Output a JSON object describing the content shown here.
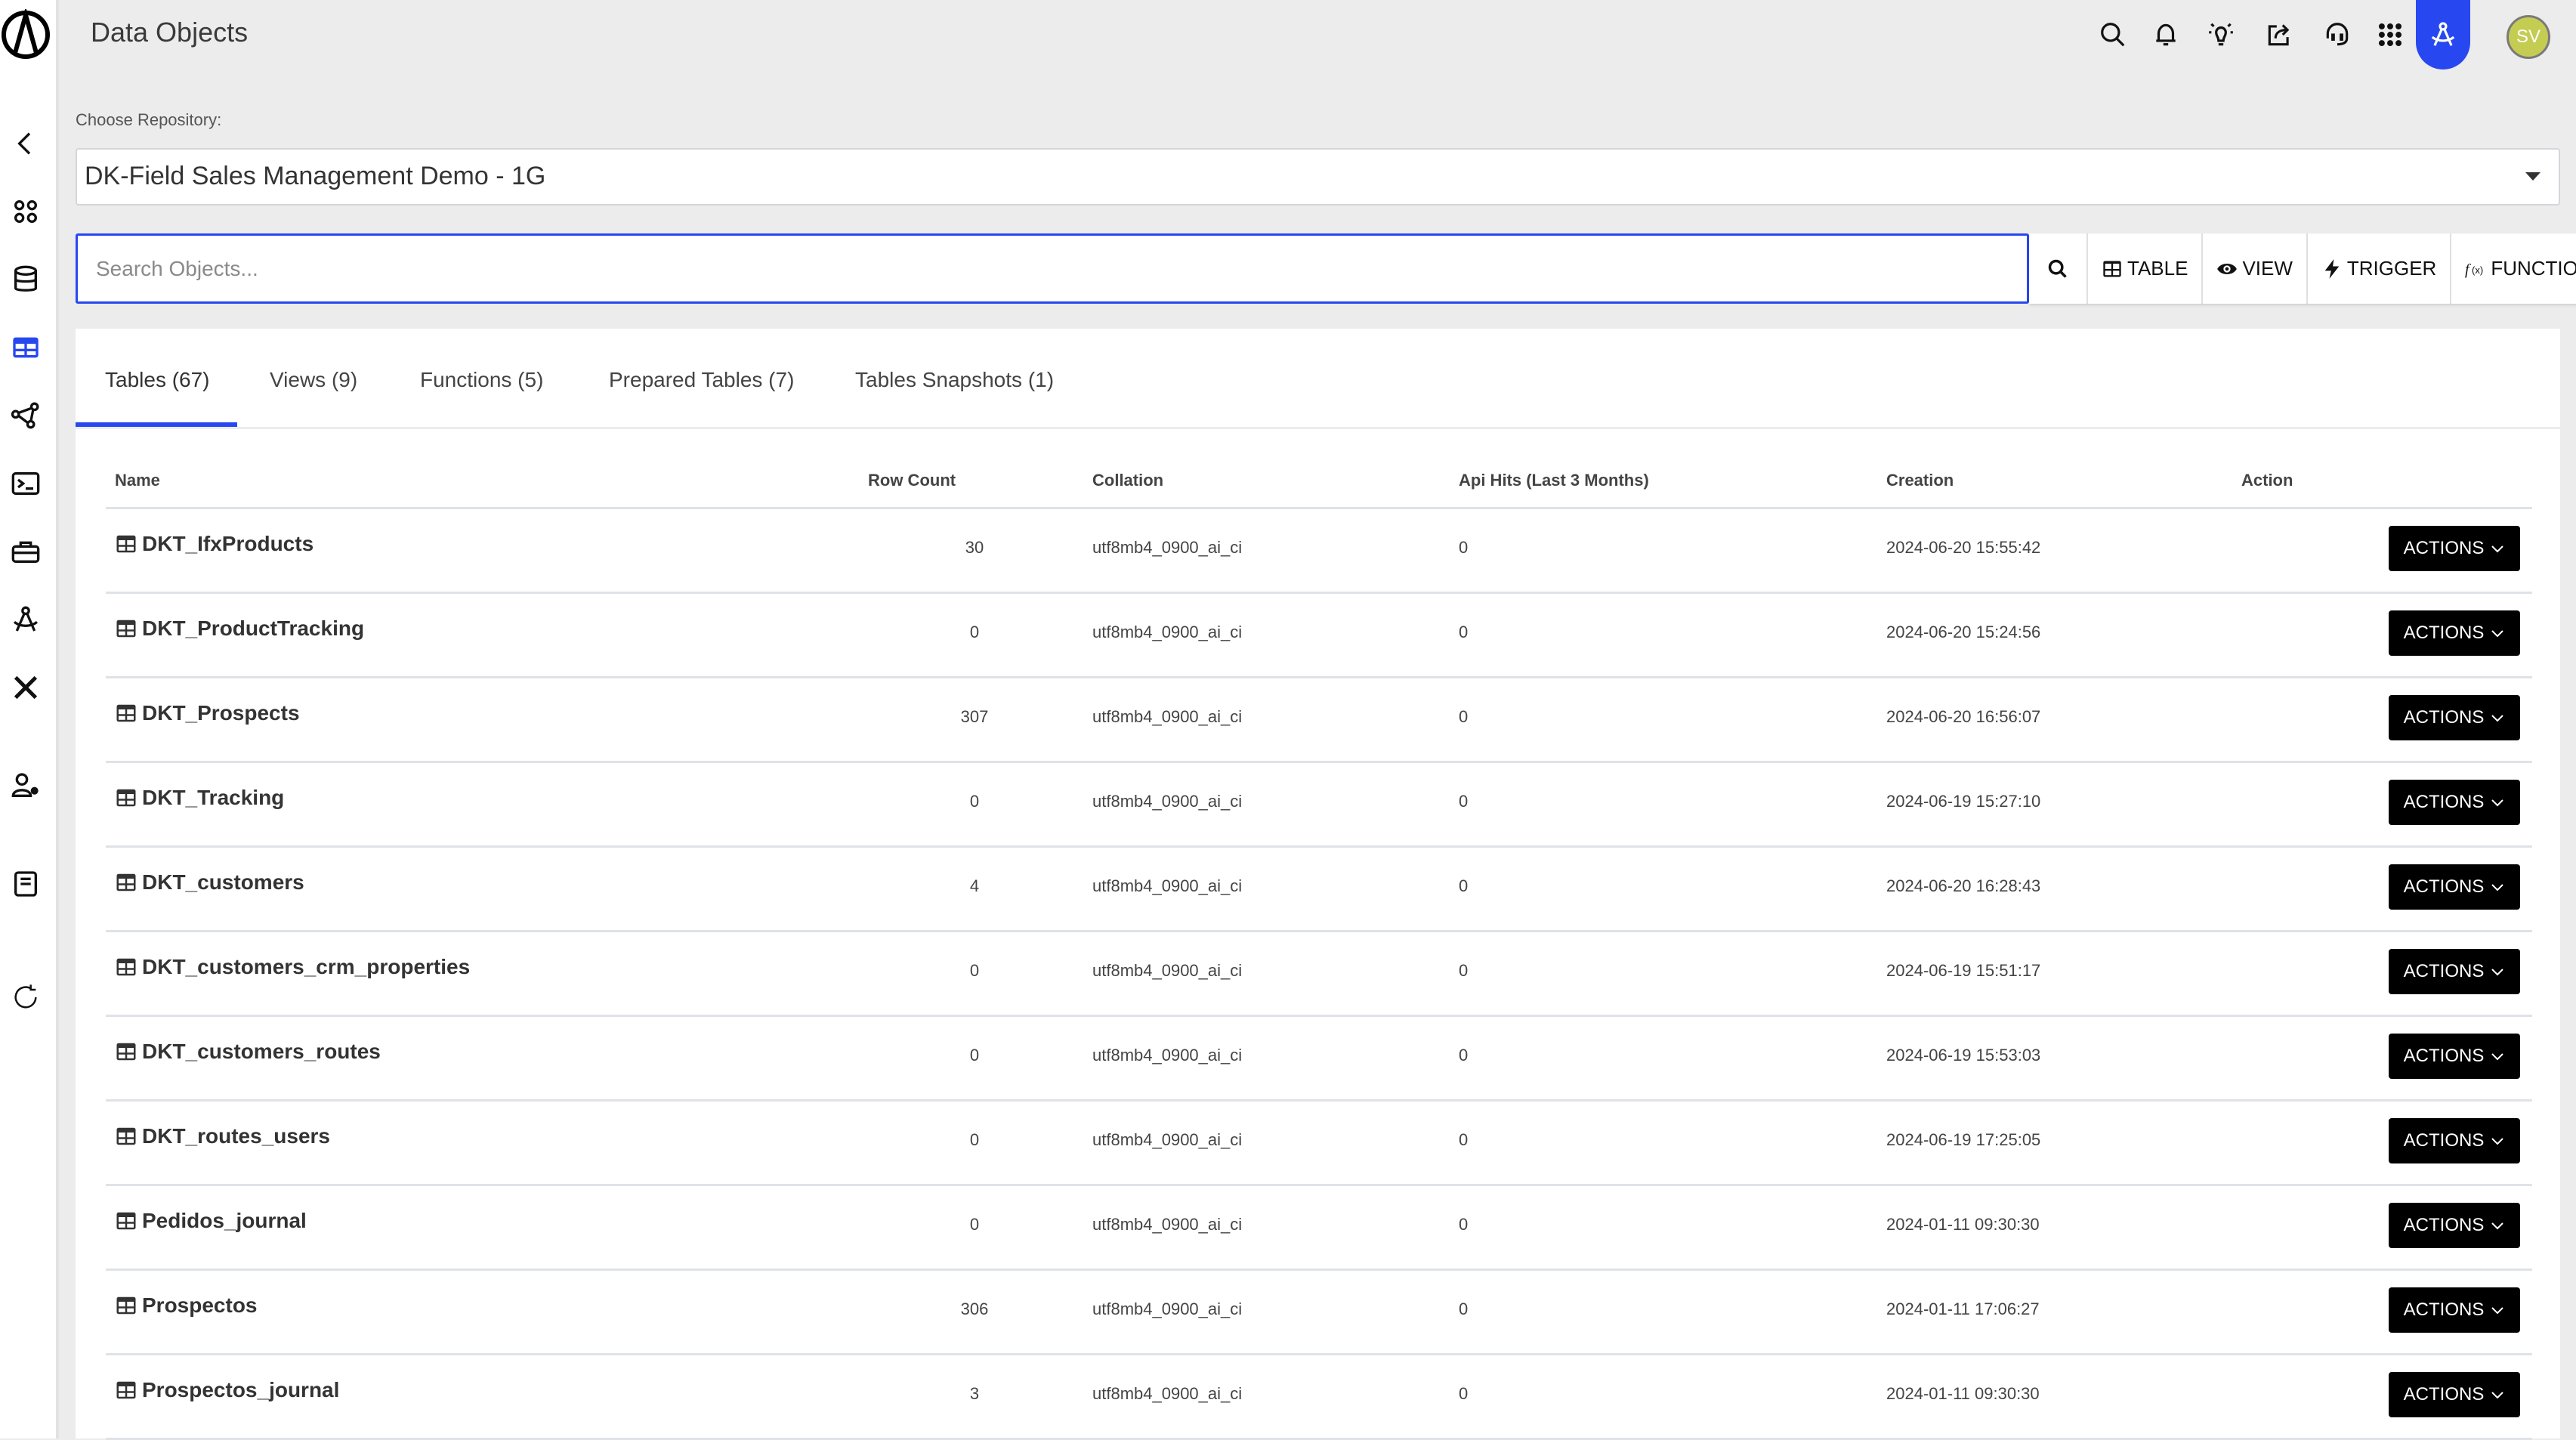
{
  "app": {
    "title": "Data Objects"
  },
  "user": {
    "initials": "SV"
  },
  "colors": {
    "accent": "#2748f0",
    "avatar": "#c5cc52",
    "actionButton": "#000000"
  },
  "topbar": {
    "icons": [
      "search-icon",
      "bell-icon",
      "lightbulb-icon",
      "share-icon",
      "headset-icon",
      "apps-grid-icon",
      "compass-icon"
    ]
  },
  "sidebar": {
    "items": [
      "collapse-chevron-icon",
      "dashboard-icon",
      "database-icon",
      "data-objects-icon",
      "graph-icon",
      "terminal-icon",
      "toolbox-icon",
      "compass-icon",
      "tools-icon",
      "user-settings-icon",
      "book-icon",
      "refresh-icon"
    ],
    "active": "data-objects-icon"
  },
  "repository": {
    "label": "Choose Repository:",
    "selected": "DK-Field Sales Management Demo - 1G"
  },
  "search": {
    "placeholder": "Search Objects...",
    "value": ""
  },
  "create_buttons": {
    "table": "TABLE",
    "view": "VIEW",
    "trigger": "TRIGGER",
    "function": "FUNCTION"
  },
  "tabs": [
    {
      "label": "Tables (67)",
      "active": true
    },
    {
      "label": "Views (9)",
      "active": false
    },
    {
      "label": "Functions (5)",
      "active": false
    },
    {
      "label": "Prepared Tables (7)",
      "active": false
    },
    {
      "label": "Tables Snapshots (1)",
      "active": false
    }
  ],
  "table": {
    "columns": [
      "Name",
      "Row Count",
      "Collation",
      "Api Hits (Last 3 Months)",
      "Creation",
      "Action"
    ],
    "action_label": "ACTIONS",
    "rows": [
      {
        "name": "DKT_IfxProducts",
        "row_count": "30",
        "collation": "utf8mb4_0900_ai_ci",
        "api_hits": "0",
        "creation": "2024-06-20 15:55:42"
      },
      {
        "name": "DKT_ProductTracking",
        "row_count": "0",
        "collation": "utf8mb4_0900_ai_ci",
        "api_hits": "0",
        "creation": "2024-06-20 15:24:56"
      },
      {
        "name": "DKT_Prospects",
        "row_count": "307",
        "collation": "utf8mb4_0900_ai_ci",
        "api_hits": "0",
        "creation": "2024-06-20 16:56:07"
      },
      {
        "name": "DKT_Tracking",
        "row_count": "0",
        "collation": "utf8mb4_0900_ai_ci",
        "api_hits": "0",
        "creation": "2024-06-19 15:27:10"
      },
      {
        "name": "DKT_customers",
        "row_count": "4",
        "collation": "utf8mb4_0900_ai_ci",
        "api_hits": "0",
        "creation": "2024-06-20 16:28:43"
      },
      {
        "name": "DKT_customers_crm_properties",
        "row_count": "0",
        "collation": "utf8mb4_0900_ai_ci",
        "api_hits": "0",
        "creation": "2024-06-19 15:51:17"
      },
      {
        "name": "DKT_customers_routes",
        "row_count": "0",
        "collation": "utf8mb4_0900_ai_ci",
        "api_hits": "0",
        "creation": "2024-06-19 15:53:03"
      },
      {
        "name": "DKT_routes_users",
        "row_count": "0",
        "collation": "utf8mb4_0900_ai_ci",
        "api_hits": "0",
        "creation": "2024-06-19 17:25:05"
      },
      {
        "name": "Pedidos_journal",
        "row_count": "0",
        "collation": "utf8mb4_0900_ai_ci",
        "api_hits": "0",
        "creation": "2024-01-11 09:30:30"
      },
      {
        "name": "Prospectos",
        "row_count": "306",
        "collation": "utf8mb4_0900_ai_ci",
        "api_hits": "0",
        "creation": "2024-01-11 17:06:27"
      },
      {
        "name": "Prospectos_journal",
        "row_count": "3",
        "collation": "utf8mb4_0900_ai_ci",
        "api_hits": "0",
        "creation": "2024-01-11 09:30:30"
      }
    ]
  }
}
